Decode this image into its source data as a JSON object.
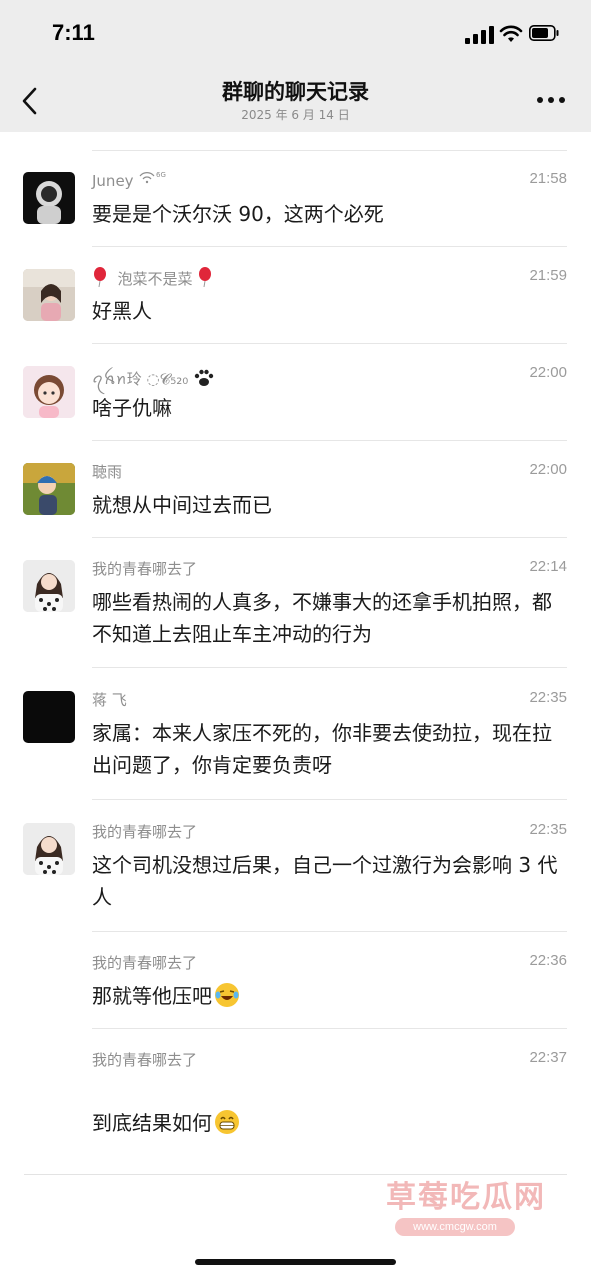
{
  "status": {
    "time": "7:11"
  },
  "header": {
    "title": "群聊的聊天记录",
    "date": "2025 年 6 月 14 日"
  },
  "messages": [
    {
      "sender": "Juney",
      "time": "21:58",
      "text": "要是是个沃尔沃 90，这两个必死"
    },
    {
      "sender": "泡菜不是菜",
      "time": "21:59",
      "text": "好黑人"
    },
    {
      "sender": "ꪖꫝꪀ玲 ◌𝓒₅₂₀",
      "time": "22:00",
      "text": "啥子仇嘛"
    },
    {
      "sender": "聴雨",
      "time": "22:00",
      "text": "就想从中间过去而已"
    },
    {
      "sender": "我的青春哪去了",
      "time": "22:14",
      "text": "哪些看热闹的人真多，不嫌事大的还拿手机拍照，都不知道上去阻止车主冲动的行为"
    },
    {
      "sender": "蒋 飞",
      "time": "22:35",
      "text": "家属：本来人家压不死的，你非要去使劲拉，现在拉出问题了，你肯定要负责呀"
    },
    {
      "sender": "我的青春哪去了",
      "time": "22:35",
      "text": "这个司机没想过后果，自己一个过激行为会影响 3 代人"
    },
    {
      "sender": "我的青春哪去了",
      "time": "22:36",
      "text": "那就等他压吧"
    },
    {
      "sender": "我的青春哪去了",
      "time": "22:37",
      "text": "到底结果如何"
    }
  ],
  "watermark": {
    "text": "草莓吃瓜网",
    "url": "www.cmcgw.com"
  },
  "icons": {
    "back": "chevron-left-icon",
    "more": "more-dots-icon",
    "wifi_badge": "wifi-6g-icon",
    "balloon": "balloon-emoji-icon",
    "paw": "paw-emoji-icon",
    "laugh_cry": "laughing-emoji-icon",
    "grin": "grinning-emoji-icon"
  },
  "colors": {
    "header_bg": "#ededed",
    "meta_text": "#8e8e8e"
  }
}
